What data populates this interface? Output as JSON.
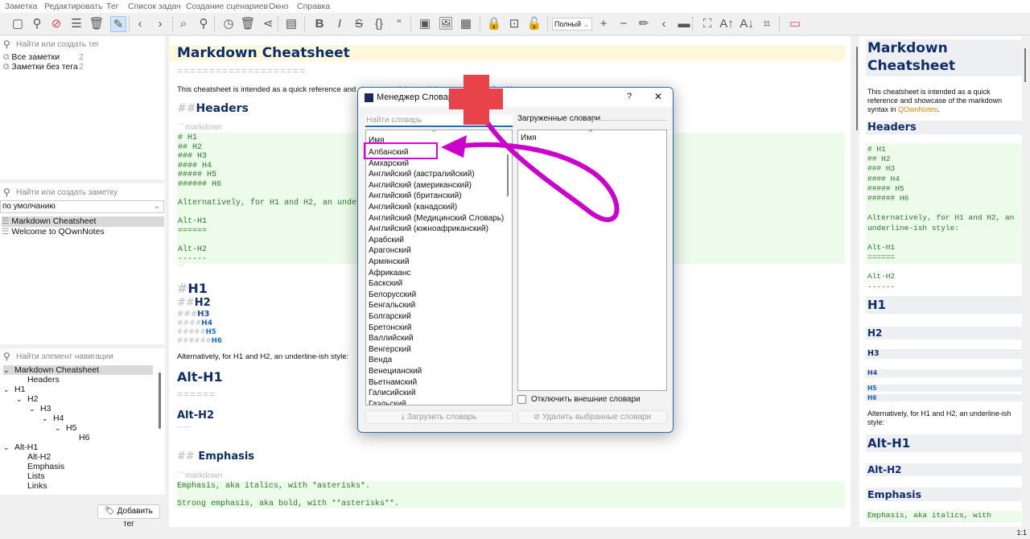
{
  "menu": [
    "Заметка",
    "Редактировать",
    "Тег",
    "Список задач",
    "Создание сценариев",
    "Окно",
    "Справка"
  ],
  "toolbar": {
    "icons": [
      {
        "name": "new-note-icon",
        "glyph": "▢"
      },
      {
        "name": "search-icon",
        "glyph": "⚲"
      },
      {
        "name": "disable-icon",
        "glyph": "⊘"
      },
      {
        "name": "note-list-icon",
        "glyph": "☰"
      },
      {
        "name": "trash-icon",
        "glyph": "🗑"
      },
      {
        "name": "edit-pencil-icon",
        "glyph": "✎"
      },
      {
        "name": "back-icon",
        "glyph": "‹"
      },
      {
        "name": "forward-icon",
        "glyph": "›"
      },
      {
        "name": "zoom-find-icon",
        "glyph": "⌕"
      },
      {
        "name": "find-in-notes-icon",
        "glyph": "⚲"
      },
      {
        "name": "history-icon",
        "glyph": "◷"
      },
      {
        "name": "trash-bin-icon",
        "glyph": "🗑"
      },
      {
        "name": "share-icon",
        "glyph": "⋖"
      },
      {
        "name": "table-of-contents-icon",
        "glyph": "▤"
      },
      {
        "name": "bold-icon",
        "glyph": "B"
      },
      {
        "name": "italic-icon",
        "glyph": "I"
      },
      {
        "name": "strikethrough-icon",
        "glyph": "S"
      },
      {
        "name": "code-braces-icon",
        "glyph": "{}"
      },
      {
        "name": "quote-icon",
        "glyph": "“"
      },
      {
        "name": "insert-link-icon",
        "glyph": "▣"
      },
      {
        "name": "insert-image-icon",
        "glyph": "🖼"
      },
      {
        "name": "insert-date-icon",
        "glyph": "▦"
      },
      {
        "name": "lock-icon",
        "glyph": "🔒"
      },
      {
        "name": "encrypt-icon",
        "glyph": "⊡"
      },
      {
        "name": "unlock-icon",
        "glyph": "🔓"
      },
      {
        "name": "zoom-in-icon",
        "glyph": "+"
      },
      {
        "name": "zoom-out-icon",
        "glyph": "−"
      },
      {
        "name": "pencil-icon",
        "glyph": "✏"
      },
      {
        "name": "collapse-icon",
        "glyph": "‹"
      },
      {
        "name": "panel-layout-icon",
        "glyph": "▬"
      },
      {
        "name": "fullscreen-icon",
        "glyph": "⛶"
      },
      {
        "name": "font-increase-icon",
        "glyph": "A↑"
      },
      {
        "name": "font-decrease-icon",
        "glyph": "A↓"
      },
      {
        "name": "distraction-free-icon",
        "glyph": "⌗"
      },
      {
        "name": "close-panel-icon",
        "glyph": "▭"
      }
    ],
    "view_mode": "Полный"
  },
  "tags": {
    "search_placeholder": "Найти или создать тег",
    "items": [
      {
        "label": "Все заметки",
        "count": "2"
      },
      {
        "label": "Заметки без тега",
        "count": "2"
      }
    ],
    "add_tag": "Добавить тег"
  },
  "notes": {
    "search_placeholder": "Найти или создать заметку",
    "sort": "по умолчанию",
    "items": [
      "Markdown Cheatsheet",
      "Welcome to QOwnNotes"
    ]
  },
  "navigation": {
    "search_placeholder": "Найти элемент навигации",
    "items": [
      "Markdown Cheatsheet",
      "Headers",
      "H1",
      "H2",
      "H3",
      "H4",
      "H5",
      "H6",
      "Alt-H1",
      "Alt-H2",
      "Emphasis",
      "Lists",
      "Links"
    ]
  },
  "editor": {
    "title": "Markdown Cheatsheet",
    "title_underline": "====================",
    "intro": "This cheatsheet is intended as a quick reference and showcase of the markdown syntax in QOwnNotes.",
    "headers_hash": "##",
    "headers": "Headers",
    "fence_open": "```markdown",
    "code_lines": [
      "# H1",
      "## H2",
      "### H3",
      "#### H4",
      "##### H5",
      "###### H6",
      "",
      "Alternatively, for H1 and H2, an underline-ish style:",
      "",
      "Alt-H1",
      "======",
      "",
      "Alt-H2",
      "------"
    ],
    "fence_close": "```",
    "h_hashes": [
      "#",
      "##",
      "###",
      "####",
      "#####",
      "######"
    ],
    "h_labels": [
      "H1",
      "H2",
      "H3",
      "H4",
      "H5",
      "H6"
    ],
    "alt_text": "Alternatively, for H1 and H2, an underline-ish style:",
    "alt_h1": "Alt-H1",
    "alt_h1_ul": "======",
    "alt_h2": "Alt-H2",
    "alt_h2_ul": "------",
    "emphasis": "Emphasis",
    "emph_lines": [
      "Emphasis, aka italics, with *asterisks*.",
      "Strong emphasis, aka bold, with **asterisks**."
    ]
  },
  "preview": {
    "title": "Markdown Cheatsheet",
    "intro": "This cheatsheet is intended as a quick reference and showcase of the markdown syntax in",
    "intro_link": "QOwnNotes",
    "link_color": "#e8830c",
    "headers": "Headers",
    "code_lines": [
      "# H1",
      "## H2",
      "### H3",
      "#### H4",
      "##### H5",
      "###### H6",
      "",
      "Alternatively, for H1 and H2, an",
      "underline-ish style:",
      "",
      "Alt-H1",
      "======",
      "",
      "Alt-H2",
      "------"
    ],
    "h": [
      "H1",
      "H2",
      "H3",
      "H4",
      "H5",
      "H6"
    ],
    "alt_text": "Alternatively, for H1 and H2, an underline-ish style:",
    "alt_h1": "Alt-H1",
    "alt_h2": "Alt-H2",
    "emphasis": "Emphasis",
    "emph_line": "Emphasis, aka italics, with"
  },
  "dialog": {
    "title": "Менеджер Словаря",
    "help": "?",
    "close": "✕",
    "search_placeholder": "Найти словарь",
    "column_name": "Имя",
    "loaded_label": "Загруженные словари",
    "loaded_column": "Имя",
    "dictionaries": [
      "Албанский",
      "Амхарский",
      "Английский (австралийский)",
      "Английский (американский)",
      "Английский (британский)",
      "Английский (канадский)",
      "Английский (Медицинский Словарь)",
      "Английский (южноафриканский)",
      "Арабский",
      "Арагонский",
      "Армянский",
      "Африкаанс",
      "Баскский",
      "Белорусский",
      "Бенгальский",
      "Болгарский",
      "Бретонский",
      "Валлийский",
      "Венгерский",
      "Венда",
      "Венецианский",
      "Вьетнамский",
      "Галисийский",
      "Гаэльский"
    ],
    "highlighted": "Албанский",
    "disable_external": "Отключить внешние словари",
    "disable_external_checked": false,
    "download_button": "Загрузить словарь",
    "delete_button": "Удалить выбранные словари"
  },
  "annotation": {
    "plus_color": "#e8434a",
    "arrow_color": "#cc00cc"
  },
  "status": {
    "position": "1:1"
  }
}
